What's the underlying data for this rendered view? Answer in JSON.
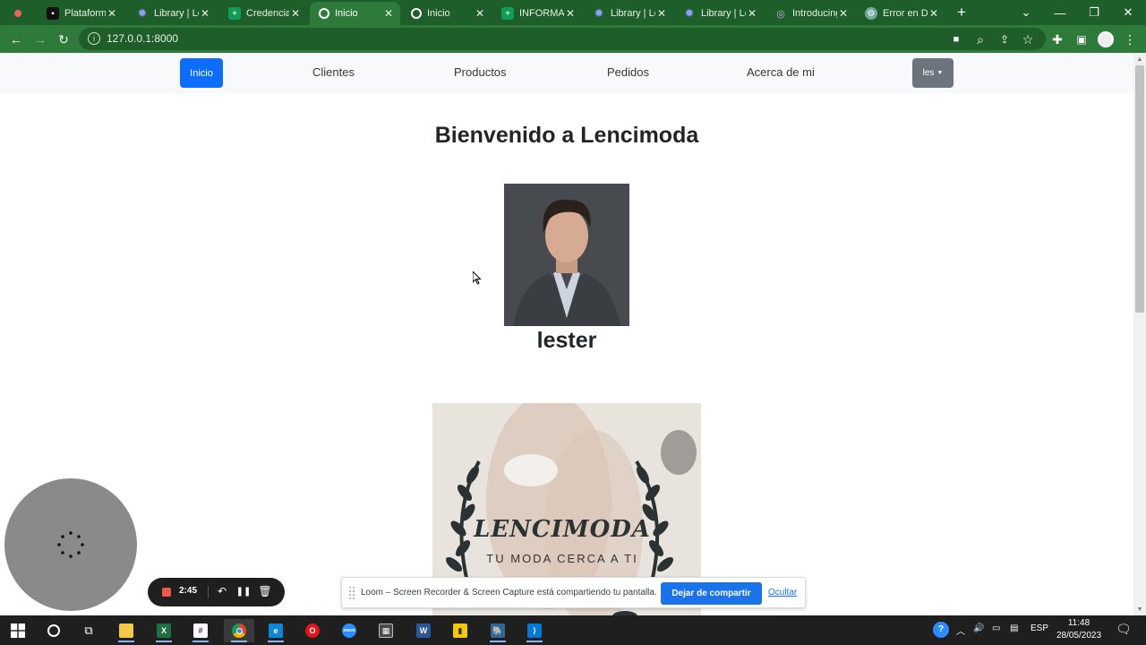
{
  "browser": {
    "tabs": [
      {
        "label": "Plataforma",
        "icon": "globe-icon",
        "color": "#333333"
      },
      {
        "label": "Library | Lo",
        "icon": "gear-icon",
        "color": "#5c6bc0"
      },
      {
        "label": "Credenciale",
        "icon": "sheets-icon",
        "color": "#0f9d58"
      },
      {
        "label": "Inicio",
        "icon": "globe-icon",
        "color": "#ffffff"
      },
      {
        "label": "Inicio",
        "icon": "globe-icon",
        "color": "#ffffff"
      },
      {
        "label": "INFORMAC",
        "icon": "sheets-icon",
        "color": "#0f9d58"
      },
      {
        "label": "Library | Lo",
        "icon": "gear-icon",
        "color": "#5c6bc0"
      },
      {
        "label": "Library | Lo",
        "icon": "gear-icon",
        "color": "#5c6bc0"
      },
      {
        "label": "Introducing",
        "icon": "globe-icon",
        "color": "#a07fc7"
      },
      {
        "label": "Error en D",
        "icon": "chatgpt-icon",
        "color": "#74aa9c"
      }
    ],
    "address": "127.0.0.1:8000"
  },
  "navbar": {
    "items": [
      "Inicio",
      "Clientes",
      "Productos",
      "Pedidos",
      "Acerca de mi"
    ],
    "user_menu": "les"
  },
  "main": {
    "title": "Bienvenido a Lencimoda",
    "person_name": "lester",
    "banner": {
      "brand": "LENCIMODA",
      "slogan": "TU MODA CERCA A  TI"
    }
  },
  "loom": {
    "timer": "2:45",
    "share_message": "Loom – Screen Recorder & Screen Capture está compartiendo tu pantalla.",
    "stop_label": "Dejar de compartir",
    "hide_label": "Ocultar"
  },
  "taskbar": {
    "language": "ESP",
    "time": "11:48",
    "date": "28/05/2023"
  },
  "colors": {
    "chrome_frame": "#1e5e2a",
    "chrome_toolbar": "#2d7a3a",
    "primary_button": "#0d6efd",
    "secondary_button": "#6c757d"
  }
}
